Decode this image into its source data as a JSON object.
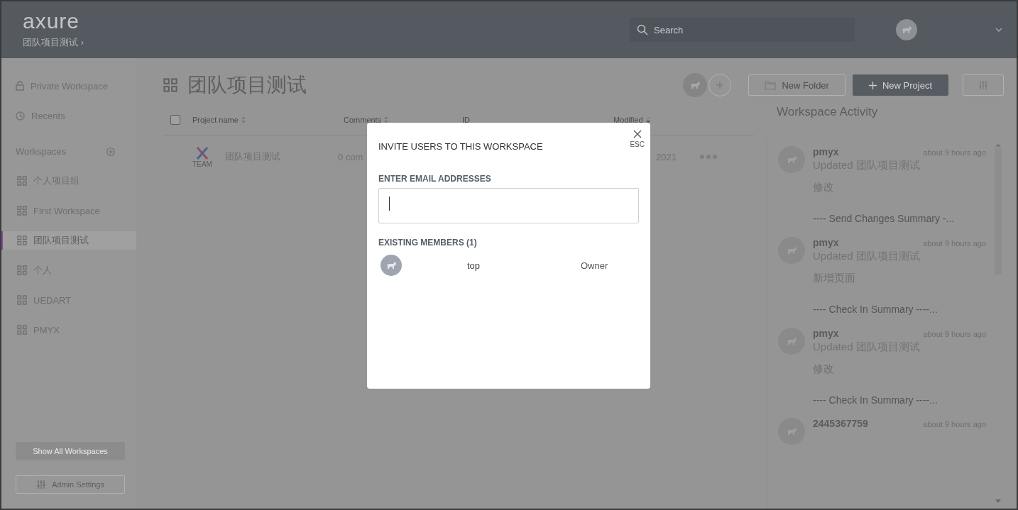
{
  "header": {
    "logo": "axure",
    "workspace": "团队项目测试",
    "workspace_chevron": "›",
    "search": {
      "placeholder": "Search"
    }
  },
  "sidebar": {
    "nav": [
      {
        "label": "Private Workspace",
        "kind": "lock"
      },
      {
        "label": "Recents",
        "kind": "clock"
      }
    ],
    "workspaces_title": "Workspaces",
    "workspaces": [
      {
        "label": "个人项目组",
        "selected": false
      },
      {
        "label": "First Workspace",
        "selected": false
      },
      {
        "label": "团队项目测试",
        "selected": true
      },
      {
        "label": "个人",
        "selected": false
      },
      {
        "label": "UEDART",
        "selected": false
      },
      {
        "label": "PMYX",
        "selected": false
      }
    ],
    "buttons": [
      {
        "label": "Show All Workspaces",
        "kind": "filled"
      },
      {
        "label": "Admin Settings",
        "kind": "outline"
      }
    ]
  },
  "main": {
    "title": "团队项目测试",
    "buttons": [
      {
        "label": "New Folder",
        "kind": "folder"
      },
      {
        "label": "New Project",
        "kind": "primary"
      }
    ],
    "table": {
      "select_all_checked": false,
      "columns": [
        "Project name",
        "Comments",
        "ID",
        "Modified"
      ],
      "rows": [
        {
          "badge": "TEAM",
          "name": "团队项目测试",
          "comments": "0 com",
          "modified": "2021"
        }
      ]
    }
  },
  "activity": {
    "title": "Workspace Activity",
    "items": [
      {
        "user": "pmyx",
        "time": "about 9 hours ago",
        "action": "Updated 团队项目测试",
        "message": "修改",
        "summary": "---- Send Changes Summary -..."
      },
      {
        "user": "pmyx",
        "time": "about 9 hours ago",
        "action": "Updated 团队项目测试",
        "message": "新增页面",
        "summary": "---- Check In Summary ----..."
      },
      {
        "user": "pmyx",
        "time": "about 9 hours ago",
        "action": "Updated 团队项目测试",
        "message": "修改",
        "summary": "---- Check In Summary ----..."
      },
      {
        "user": "2445367759",
        "time": "about 9 hours ago"
      }
    ]
  },
  "dialog": {
    "title": "INVITE USERS TO THIS WORKSPACE",
    "close_hint": "ESC",
    "email_label": "ENTER EMAIL ADDRESSES",
    "members_label": "EXISTING MEMBERS (1)",
    "members": [
      {
        "email": "top",
        "role": "Owner"
      }
    ]
  }
}
